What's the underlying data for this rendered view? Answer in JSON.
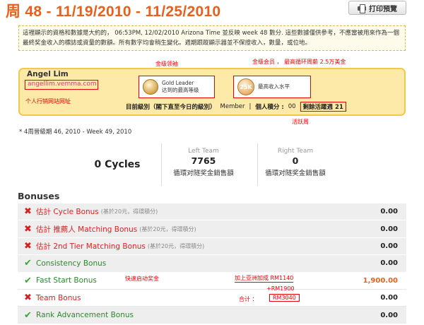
{
  "header": {
    "week_title": "周 48 - 11/19/2010 - 11/25/2010",
    "print_label": "打印預覽"
  },
  "notice": {
    "text": "這裡顯示的資格和數據是大約的， 06:53PM, 12/02/2010 Arizona Time 並反映 week 48 數分. 這些數據僅供參考，不應當被用來作為一個最終奖金收入的標誌或資量的數額。所有數字均會稍生變化。週期跟蹤顯示器並不保證收入，數量，或位地。"
  },
  "member": {
    "name": "Angel Lim",
    "website": "angellim.vemma.com",
    "website_annotation": "个人行销网站网址",
    "gold_annotation": "金级领袖",
    "gold_title": "Gold Leader",
    "gold_sub": "达到的最高等级",
    "k25_annotation": "金级会员 ， 最高循环周薪 2.5万美金",
    "k25_badge": "25K",
    "k25_sub": "最高收入水平",
    "rank_label": "目前級別（閣下直至今日的級別）",
    "rank_value": "Member",
    "points_label": "個人積分 :",
    "points_value": "00",
    "active_label": "剩餘活躍週",
    "active_value": "21",
    "active_annotation": "活跃周"
  },
  "four_week": "* 4周晉級期 46, 2010 - Week 49, 2010",
  "stats": {
    "cycles": "0 Cycles",
    "left_label": "Left Team",
    "left_value": "7765",
    "left_sub": "循環对隧奖金銷售額",
    "right_label": "Right Team",
    "right_value": "0",
    "right_sub": "循環对隧奖金銷售額"
  },
  "bonuses": {
    "title": "Bonuses",
    "rows": [
      {
        "status": "x",
        "label": "估計 Cycle Bonus",
        "note": "(基於20元，得環積分)",
        "amount": "0.00",
        "color": "red"
      },
      {
        "status": "x",
        "label": "估計 推薦人 Matching Bonus",
        "note": "(基於20元，得環積分)",
        "amount": "0.00",
        "color": "red"
      },
      {
        "status": "x",
        "label": "估計 2nd Tier Matching Bonus",
        "note": "(基於20元，得環積分)",
        "amount": "0.00",
        "color": "red"
      },
      {
        "status": "ok",
        "label": "Consistency Bonus",
        "note": "",
        "amount": "0.00",
        "color": "green"
      },
      {
        "status": "ok",
        "label": "Fast Start Bonus",
        "note": "",
        "amount": "1,900.00",
        "color": "green"
      },
      {
        "status": "x",
        "label": "Team Bonus",
        "note": "",
        "amount": "0.00",
        "color": "red"
      },
      {
        "status": "ok",
        "label": "Rank Advancement Bonus",
        "note": "",
        "amount": "0.00",
        "color": "green"
      }
    ],
    "fast_start_annotation": "快速启动奖金",
    "asia_bonus": "加上亚洲加成 RM1140",
    "plus_rm": "+RM1900",
    "total_label": "合计 ：",
    "total_value": "RM3040"
  },
  "colors": {
    "accent": "#e8601c",
    "annotation_red": "#e00000",
    "success_green": "#3aa63a",
    "fail_red": "#d42020"
  }
}
